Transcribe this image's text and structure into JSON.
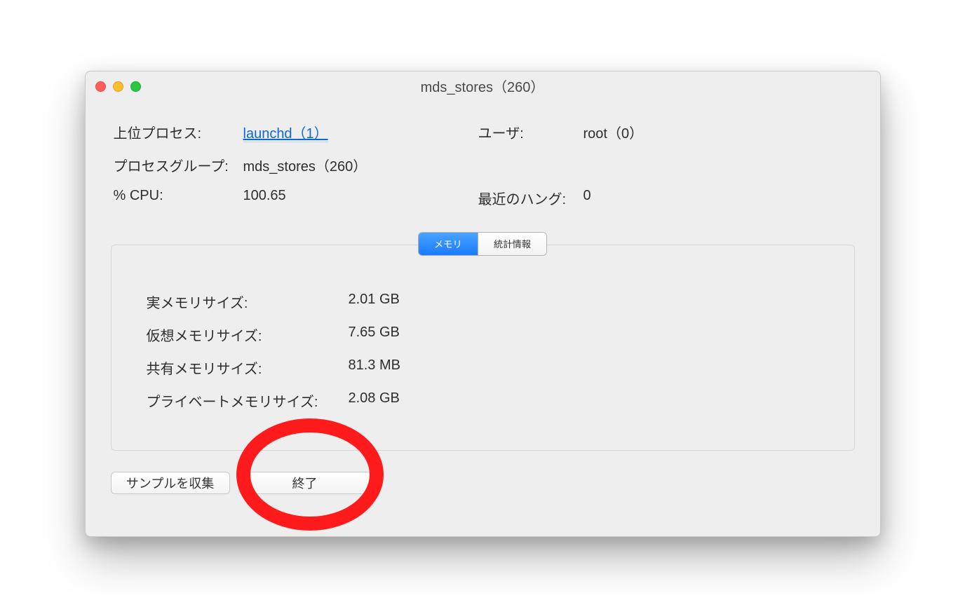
{
  "title": "mds_stores（260）",
  "info": {
    "parent_label": "上位プロセス:",
    "parent_value": "launchd（1）",
    "user_label": "ユーザ:",
    "user_value": "root（0）",
    "group_label": "プロセスグループ:",
    "group_value": "mds_stores（260）",
    "cpu_label": "% CPU:",
    "cpu_value": "100.65",
    "hang_label": "最近のハング:",
    "hang_value": "0"
  },
  "tabs": {
    "memory": "メモリ",
    "stats": "統計情報"
  },
  "memory": {
    "real_label": "実メモリサイズ:",
    "real_value": "2.01 GB",
    "virtual_label": "仮想メモリサイズ:",
    "virtual_value": "7.65 GB",
    "shared_label": "共有メモリサイズ:",
    "shared_value": "81.3 MB",
    "private_label": "プライベートメモリサイズ:",
    "private_value": "2.08 GB"
  },
  "buttons": {
    "sample": "サンプルを収集",
    "quit": "終了"
  }
}
